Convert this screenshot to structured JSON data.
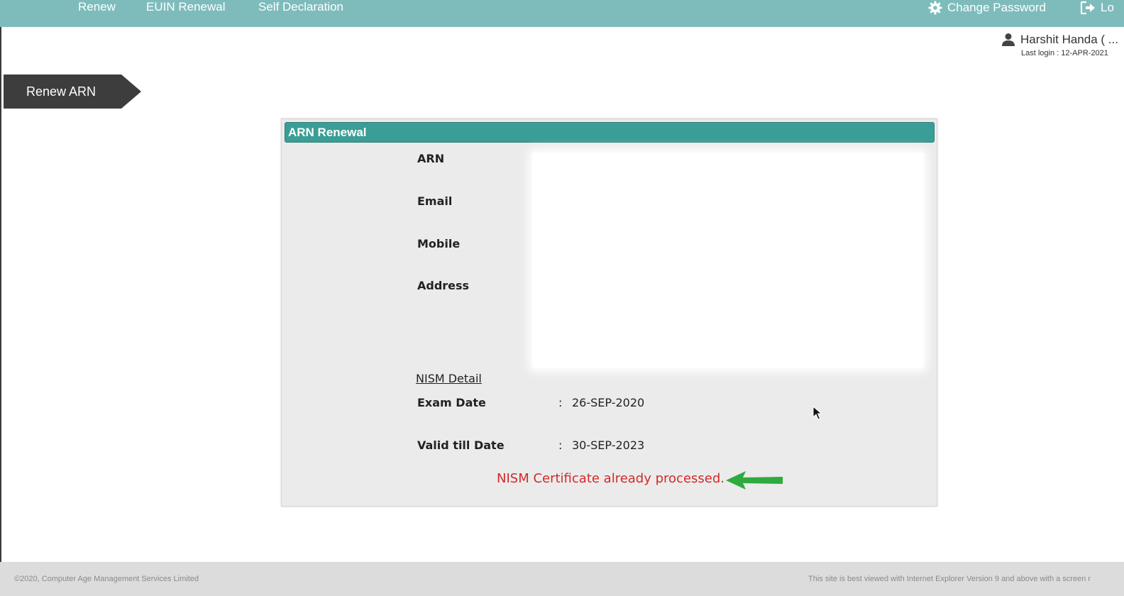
{
  "nav": {
    "renew": "Renew",
    "euin_renewal": "EUIN Renewal",
    "self_declaration": "Self Declaration",
    "change_password": "Change Password",
    "logout": "Lo"
  },
  "user": {
    "name": "Harshit Handa ( ...",
    "last_login": "Last login : 12-APR-2021"
  },
  "section_tab": "Renew ARN",
  "panel": {
    "title": "ARN Renewal",
    "labels": {
      "arn": "ARN",
      "email": "Email",
      "mobile": "Mobile",
      "address": "Address"
    },
    "nism": {
      "title": "NISM Detail",
      "exam_date_label": "Exam Date",
      "exam_date_value": "26-SEP-2020",
      "valid_till_label": "Valid till Date",
      "valid_till_value": "30-SEP-2023",
      "colon": ":"
    },
    "status_message": "NISM Certificate already processed."
  },
  "footer": {
    "copyright": "©2020, Computer Age Management Services Limited",
    "browser_note": "This site is best viewed with Internet Explorer Version 9 and above with a screen r"
  },
  "colors": {
    "nav_bg": "#7ebcbc",
    "panel_header_bg": "#3a9e96",
    "status_red": "#d12a2a",
    "arrow_green": "#2eaa3e",
    "tab_bg": "#3d3d3d"
  }
}
